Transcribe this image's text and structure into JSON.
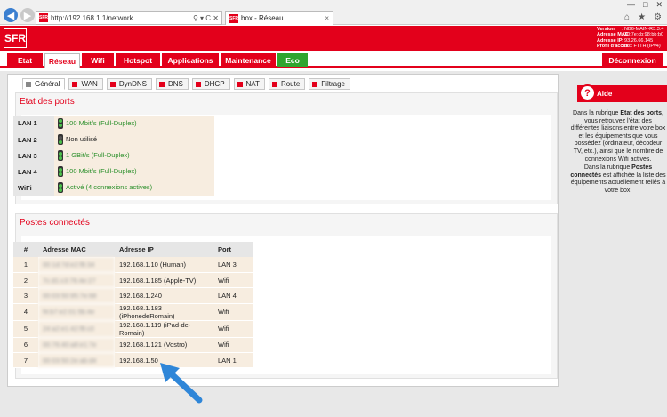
{
  "browser": {
    "url": "http://192.168.1.1/network",
    "favicon_text": "SFR",
    "tab_title": "box - Réseau",
    "addr_tools": "⚲ ▾ C ✕",
    "tab_close": "×",
    "window_controls": [
      "—",
      "□",
      "✕"
    ],
    "toolbar_icons": [
      "⌂",
      "★",
      "⚙"
    ]
  },
  "header": {
    "logo": "SFR",
    "info": [
      {
        "k": "Version",
        "v": ": NB6-MAIN-R3.3.4"
      },
      {
        "k": "Adresse MAC",
        "v": ": 30:7e:cb:98:bb:b0"
      },
      {
        "k": "Adresse IP",
        "v": ": 93.26.66.145"
      },
      {
        "k": "Profil d'accès",
        "v": ": box FTTH (IPv4)"
      }
    ]
  },
  "nav": {
    "items": [
      "Etat",
      "Réseau",
      "Wifi",
      "Hotspot",
      "Applications",
      "Maintenance",
      "Eco"
    ],
    "logout": "Déconnexion"
  },
  "subtabs": [
    "Général",
    "WAN",
    "DynDNS",
    "DNS",
    "DHCP",
    "NAT",
    "Route",
    "Filtrage"
  ],
  "ports": {
    "title": "Etat des ports",
    "rows": [
      {
        "label": "LAN 1",
        "value": "100 Mbit/s (Full-Duplex)",
        "ok": true
      },
      {
        "label": "LAN 2",
        "value": "Non utilisé",
        "ok": false
      },
      {
        "label": "LAN 3",
        "value": "1 GBit/s (Full-Duplex)",
        "ok": true
      },
      {
        "label": "LAN 4",
        "value": "100 Mbit/s (Full-Duplex)",
        "ok": true
      },
      {
        "label": "WiFi",
        "value": "Activé (4 connexions actives)",
        "ok": true
      }
    ]
  },
  "hosts": {
    "title": "Postes connectés",
    "columns": [
      "#",
      "Adresse MAC",
      "Adresse IP",
      "Port"
    ],
    "rows": [
      {
        "n": "1",
        "mac": "00:1d:7d:e2:f8:34",
        "ip": "192.168.1.10 (Human)",
        "port": "LAN 3"
      },
      {
        "n": "2",
        "mac": "7c:d1:c3:76:4e:27",
        "ip": "192.168.1.185 (Apple-TV)",
        "port": "Wifi"
      },
      {
        "n": "3",
        "mac": "00:03:50:95:7e:68",
        "ip": "192.168.1.240",
        "port": "LAN 4"
      },
      {
        "n": "4",
        "mac": "f4:b7:e2:01:5b:4e",
        "ip": "192.168.1.183 (iPhonedeRomain)",
        "port": "Wifi"
      },
      {
        "n": "5",
        "mac": "24:a2:e1:42:f8:c0",
        "ip": "192.168.1.119 (iPad-de-Romain)",
        "port": "Wifi"
      },
      {
        "n": "6",
        "mac": "00:76:40:a8:e1:7e",
        "ip": "192.168.1.121 (Vostro)",
        "port": "Wifi"
      },
      {
        "n": "7",
        "mac": "00:03:50:2e:ab:d4",
        "ip": "192.168.1.50",
        "port": "LAN 1"
      }
    ]
  },
  "help": {
    "title": "Aide",
    "p1_pre": "Dans la rubrique ",
    "p1_bold": "Etat des ports",
    "p1_post": ", vous retrouvez l'état des différentes liaisons entre votre box et les équipements que vous possédez (ordinateur, décodeur TV, etc.), ainsi que le nombre de connexions Wifi actives.",
    "p2_pre": "Dans la rubrique ",
    "p2_bold": "Postes connectés",
    "p2_post": " est affichée la liste des équipements actuellement reliés à votre box."
  },
  "colors": {
    "brand": "#e3001b",
    "eco": "#2fa52f",
    "ok": "#2a8f2a",
    "arrow": "#2f86d8"
  }
}
